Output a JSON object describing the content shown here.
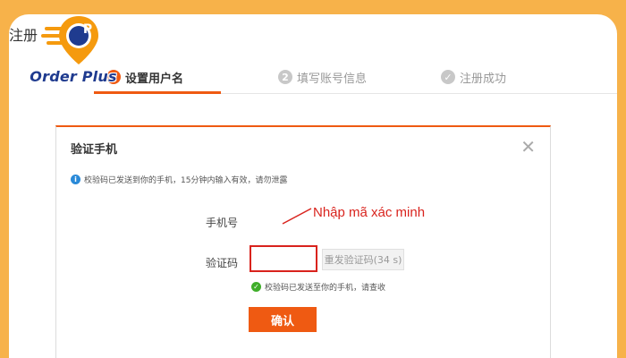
{
  "page": {
    "title": "注册"
  },
  "logo": {
    "brand": "Order Plus",
    "mark_letter": "P"
  },
  "steps": [
    {
      "num": "1",
      "label": "设置用户名"
    },
    {
      "num": "2",
      "label": "填写账号信息"
    },
    {
      "num": "✓",
      "label": "注册成功"
    }
  ],
  "dialog": {
    "title": "验证手机",
    "close": "✕",
    "notice": "校验码已发送到你的手机，15分钟内输入有效，请勿泄露",
    "phone_label": "手机号",
    "code_label": "验证码",
    "code_value": "",
    "resend_label": "重发验证码(34 s)",
    "sent_msg": "校验码已发送至你的手机，请查收",
    "confirm_label": "确认"
  },
  "annotation": {
    "text": "Nhập mã xác minh"
  },
  "colors": {
    "background": "#f7b24a",
    "accent": "#ef5a12",
    "highlight": "#d9231d",
    "brand": "#1f3b8f"
  }
}
